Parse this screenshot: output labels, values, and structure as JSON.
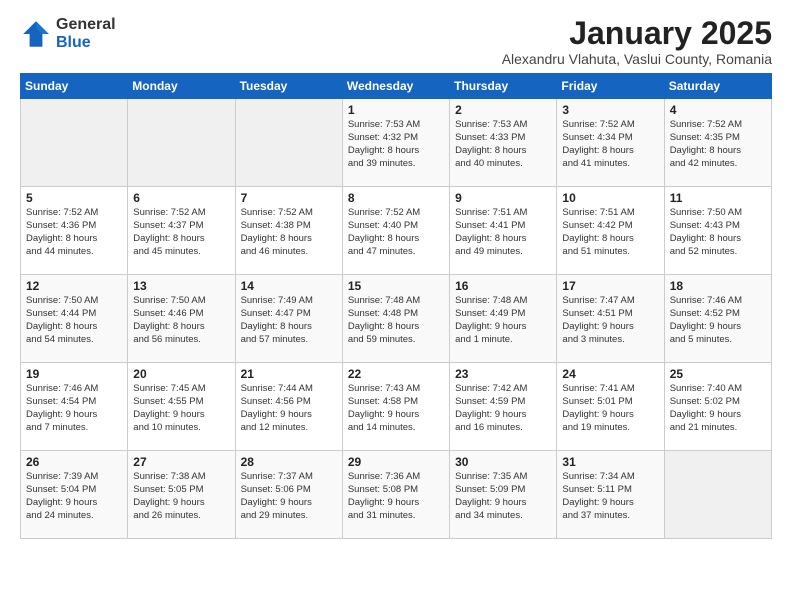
{
  "logo": {
    "general": "General",
    "blue": "Blue"
  },
  "title": "January 2025",
  "subtitle": "Alexandru Vlahuta, Vaslui County, Romania",
  "days_header": [
    "Sunday",
    "Monday",
    "Tuesday",
    "Wednesday",
    "Thursday",
    "Friday",
    "Saturday"
  ],
  "weeks": [
    [
      {
        "day": "",
        "info": ""
      },
      {
        "day": "",
        "info": ""
      },
      {
        "day": "",
        "info": ""
      },
      {
        "day": "1",
        "info": "Sunrise: 7:53 AM\nSunset: 4:32 PM\nDaylight: 8 hours\nand 39 minutes."
      },
      {
        "day": "2",
        "info": "Sunrise: 7:53 AM\nSunset: 4:33 PM\nDaylight: 8 hours\nand 40 minutes."
      },
      {
        "day": "3",
        "info": "Sunrise: 7:52 AM\nSunset: 4:34 PM\nDaylight: 8 hours\nand 41 minutes."
      },
      {
        "day": "4",
        "info": "Sunrise: 7:52 AM\nSunset: 4:35 PM\nDaylight: 8 hours\nand 42 minutes."
      }
    ],
    [
      {
        "day": "5",
        "info": "Sunrise: 7:52 AM\nSunset: 4:36 PM\nDaylight: 8 hours\nand 44 minutes."
      },
      {
        "day": "6",
        "info": "Sunrise: 7:52 AM\nSunset: 4:37 PM\nDaylight: 8 hours\nand 45 minutes."
      },
      {
        "day": "7",
        "info": "Sunrise: 7:52 AM\nSunset: 4:38 PM\nDaylight: 8 hours\nand 46 minutes."
      },
      {
        "day": "8",
        "info": "Sunrise: 7:52 AM\nSunset: 4:40 PM\nDaylight: 8 hours\nand 47 minutes."
      },
      {
        "day": "9",
        "info": "Sunrise: 7:51 AM\nSunset: 4:41 PM\nDaylight: 8 hours\nand 49 minutes."
      },
      {
        "day": "10",
        "info": "Sunrise: 7:51 AM\nSunset: 4:42 PM\nDaylight: 8 hours\nand 51 minutes."
      },
      {
        "day": "11",
        "info": "Sunrise: 7:50 AM\nSunset: 4:43 PM\nDaylight: 8 hours\nand 52 minutes."
      }
    ],
    [
      {
        "day": "12",
        "info": "Sunrise: 7:50 AM\nSunset: 4:44 PM\nDaylight: 8 hours\nand 54 minutes."
      },
      {
        "day": "13",
        "info": "Sunrise: 7:50 AM\nSunset: 4:46 PM\nDaylight: 8 hours\nand 56 minutes."
      },
      {
        "day": "14",
        "info": "Sunrise: 7:49 AM\nSunset: 4:47 PM\nDaylight: 8 hours\nand 57 minutes."
      },
      {
        "day": "15",
        "info": "Sunrise: 7:48 AM\nSunset: 4:48 PM\nDaylight: 8 hours\nand 59 minutes."
      },
      {
        "day": "16",
        "info": "Sunrise: 7:48 AM\nSunset: 4:49 PM\nDaylight: 9 hours\nand 1 minute."
      },
      {
        "day": "17",
        "info": "Sunrise: 7:47 AM\nSunset: 4:51 PM\nDaylight: 9 hours\nand 3 minutes."
      },
      {
        "day": "18",
        "info": "Sunrise: 7:46 AM\nSunset: 4:52 PM\nDaylight: 9 hours\nand 5 minutes."
      }
    ],
    [
      {
        "day": "19",
        "info": "Sunrise: 7:46 AM\nSunset: 4:54 PM\nDaylight: 9 hours\nand 7 minutes."
      },
      {
        "day": "20",
        "info": "Sunrise: 7:45 AM\nSunset: 4:55 PM\nDaylight: 9 hours\nand 10 minutes."
      },
      {
        "day": "21",
        "info": "Sunrise: 7:44 AM\nSunset: 4:56 PM\nDaylight: 9 hours\nand 12 minutes."
      },
      {
        "day": "22",
        "info": "Sunrise: 7:43 AM\nSunset: 4:58 PM\nDaylight: 9 hours\nand 14 minutes."
      },
      {
        "day": "23",
        "info": "Sunrise: 7:42 AM\nSunset: 4:59 PM\nDaylight: 9 hours\nand 16 minutes."
      },
      {
        "day": "24",
        "info": "Sunrise: 7:41 AM\nSunset: 5:01 PM\nDaylight: 9 hours\nand 19 minutes."
      },
      {
        "day": "25",
        "info": "Sunrise: 7:40 AM\nSunset: 5:02 PM\nDaylight: 9 hours\nand 21 minutes."
      }
    ],
    [
      {
        "day": "26",
        "info": "Sunrise: 7:39 AM\nSunset: 5:04 PM\nDaylight: 9 hours\nand 24 minutes."
      },
      {
        "day": "27",
        "info": "Sunrise: 7:38 AM\nSunset: 5:05 PM\nDaylight: 9 hours\nand 26 minutes."
      },
      {
        "day": "28",
        "info": "Sunrise: 7:37 AM\nSunset: 5:06 PM\nDaylight: 9 hours\nand 29 minutes."
      },
      {
        "day": "29",
        "info": "Sunrise: 7:36 AM\nSunset: 5:08 PM\nDaylight: 9 hours\nand 31 minutes."
      },
      {
        "day": "30",
        "info": "Sunrise: 7:35 AM\nSunset: 5:09 PM\nDaylight: 9 hours\nand 34 minutes."
      },
      {
        "day": "31",
        "info": "Sunrise: 7:34 AM\nSunset: 5:11 PM\nDaylight: 9 hours\nand 37 minutes."
      },
      {
        "day": "",
        "info": ""
      }
    ]
  ]
}
